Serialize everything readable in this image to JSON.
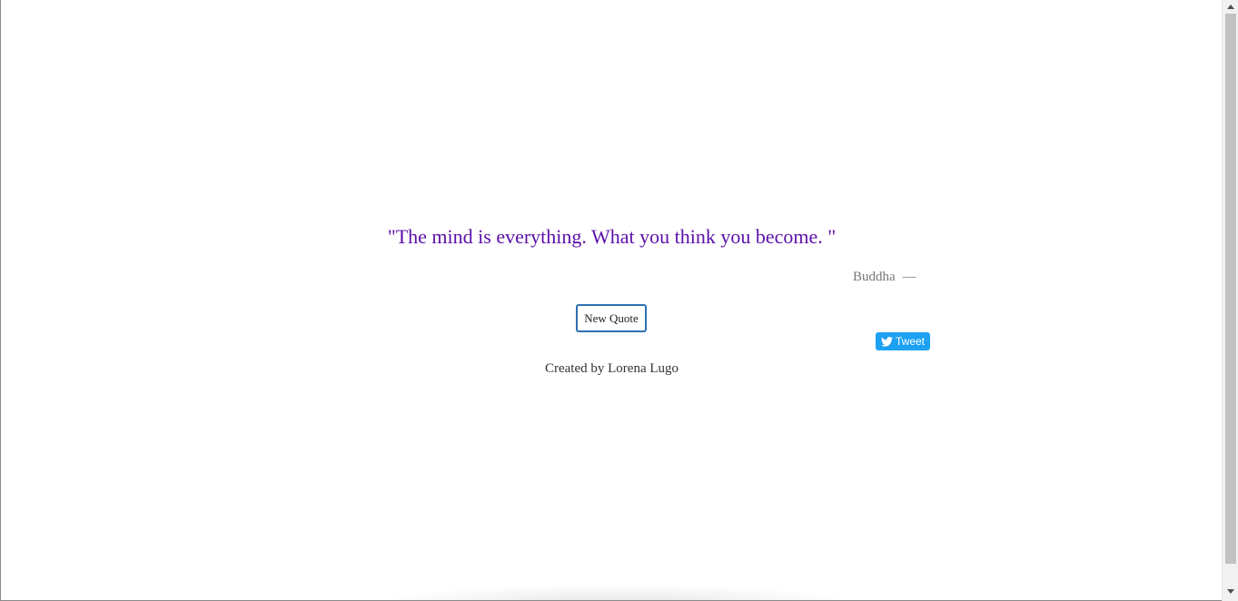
{
  "quote": {
    "text": "\"The mind is everything. What you think you become. \"",
    "author": "Buddha",
    "dash": "—"
  },
  "actions": {
    "new_quote_label": "New Quote",
    "tweet_label": "Tweet"
  },
  "footer": {
    "credit": "Created by Lorena Lugo"
  },
  "colors": {
    "quote": "#5b0fa8",
    "author": "#777777",
    "button_border": "#2f6fb0",
    "tweet_bg": "#1da1f2"
  },
  "icons": {
    "tweet": "twitter-bird-icon",
    "scroll_up": "scroll-up-arrow-icon",
    "scroll_down": "scroll-down-arrow-icon"
  }
}
